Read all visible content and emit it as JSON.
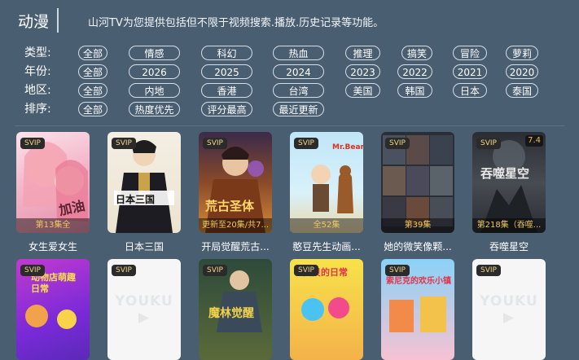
{
  "header": {
    "title": "动漫",
    "subtitle": "山河TV为您提供包括但不限于视频搜索.播放.历史记录等功能。"
  },
  "filters": [
    {
      "label": "类型:",
      "options": [
        "全部",
        "情感",
        "科幻",
        "热血",
        "推理",
        "搞笑",
        "冒险",
        "萝莉"
      ]
    },
    {
      "label": "年份:",
      "options": [
        "全部",
        "2026",
        "2025",
        "2024",
        "2023",
        "2022",
        "2021",
        "2020"
      ]
    },
    {
      "label": "地区:",
      "options": [
        "全部",
        "内地",
        "香港",
        "台湾",
        "美国",
        "韩国",
        "日本",
        "泰国"
      ]
    },
    {
      "label": "排序:",
      "options": [
        "全部",
        "热度优先",
        "评分最高",
        "最近更新"
      ]
    }
  ],
  "badge_text": "SVIP",
  "cards_row1": [
    {
      "title": "女生爱女生",
      "episode": "第13集全",
      "rating": "",
      "poster_text": "加油"
    },
    {
      "title": "日本三国",
      "episode": "",
      "rating": "",
      "poster_text": "日本三国"
    },
    {
      "title": "开局觉醒荒古...",
      "episode": "更新至20集/共7...",
      "rating": "",
      "poster_text": "荒古圣体"
    },
    {
      "title": "憨豆先生动画...",
      "episode": "全52集",
      "rating": "",
      "poster_text": "Mr.Bean"
    },
    {
      "title": "她的微笑像颗...",
      "episode": "第39集",
      "rating": "",
      "poster_text": ""
    },
    {
      "title": "吞噬星空",
      "episode": "第218集（吞噬...",
      "rating": "7.4",
      "poster_text": "吞噬星空"
    }
  ],
  "cards_row2": [
    {
      "title": "",
      "poster_text": "动物店萌趣日常"
    },
    {
      "title": "",
      "poster_text": "YOUKU ▶"
    },
    {
      "title": "",
      "poster_text": "魔林觉醒"
    },
    {
      "title": "",
      "poster_text": "贝贝的日常"
    },
    {
      "title": "",
      "poster_text": "索尼克的欢乐小镇"
    },
    {
      "title": "",
      "poster_text": "YOUKU ▶"
    }
  ],
  "colors": {
    "background": "#4a5e72",
    "chip_border": "#d6dde4",
    "badge_text": "#f3d58a",
    "episode_text": "#f0c862"
  }
}
